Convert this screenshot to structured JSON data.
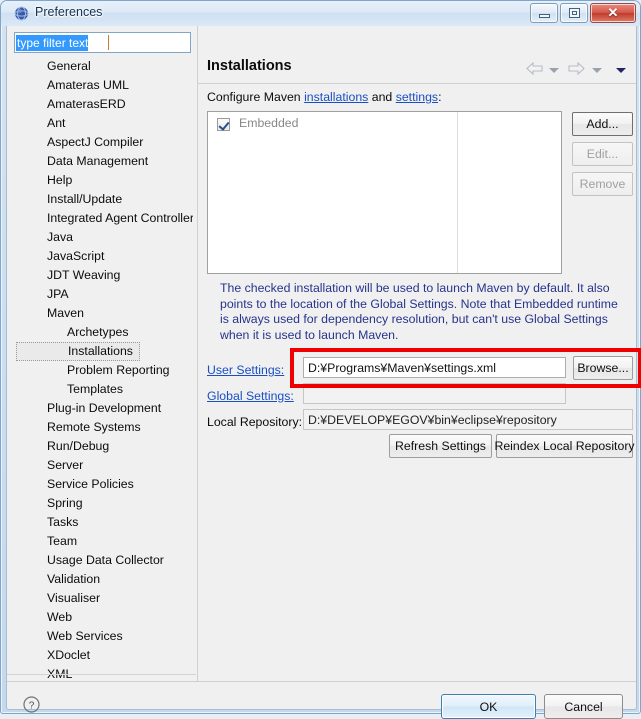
{
  "window": {
    "title": "Preferences",
    "icon": "globe-icon",
    "minimize_label": "Minimize",
    "maximize_label": "Maximize",
    "close_label": "✕"
  },
  "filter": {
    "value": "type filter text",
    "placeholder": "type filter text"
  },
  "tree": {
    "items": [
      {
        "label": "General",
        "level": 0,
        "selected": false
      },
      {
        "label": "Amateras UML",
        "level": 0,
        "selected": false
      },
      {
        "label": "AmaterasERD",
        "level": 0,
        "selected": false
      },
      {
        "label": "Ant",
        "level": 0,
        "selected": false
      },
      {
        "label": "AspectJ Compiler",
        "level": 0,
        "selected": false
      },
      {
        "label": "Data Management",
        "level": 0,
        "selected": false
      },
      {
        "label": "Help",
        "level": 0,
        "selected": false
      },
      {
        "label": "Install/Update",
        "level": 0,
        "selected": false
      },
      {
        "label": "Integrated Agent Controller",
        "level": 0,
        "selected": false
      },
      {
        "label": "Java",
        "level": 0,
        "selected": false
      },
      {
        "label": "JavaScript",
        "level": 0,
        "selected": false
      },
      {
        "label": "JDT Weaving",
        "level": 0,
        "selected": false
      },
      {
        "label": "JPA",
        "level": 0,
        "selected": false
      },
      {
        "label": "Maven",
        "level": 0,
        "selected": false
      },
      {
        "label": "Archetypes",
        "level": 1,
        "selected": false
      },
      {
        "label": "Installations",
        "level": 1,
        "selected": true
      },
      {
        "label": "Problem Reporting",
        "level": 1,
        "selected": false
      },
      {
        "label": "Templates",
        "level": 1,
        "selected": false
      },
      {
        "label": "Plug-in Development",
        "level": 0,
        "selected": false
      },
      {
        "label": "Remote Systems",
        "level": 0,
        "selected": false
      },
      {
        "label": "Run/Debug",
        "level": 0,
        "selected": false
      },
      {
        "label": "Server",
        "level": 0,
        "selected": false
      },
      {
        "label": "Service Policies",
        "level": 0,
        "selected": false
      },
      {
        "label": "Spring",
        "level": 0,
        "selected": false
      },
      {
        "label": "Tasks",
        "level": 0,
        "selected": false
      },
      {
        "label": "Team",
        "level": 0,
        "selected": false
      },
      {
        "label": "Usage Data Collector",
        "level": 0,
        "selected": false
      },
      {
        "label": "Validation",
        "level": 0,
        "selected": false
      },
      {
        "label": "Visualiser",
        "level": 0,
        "selected": false
      },
      {
        "label": "Web",
        "level": 0,
        "selected": false
      },
      {
        "label": "Web Services",
        "level": 0,
        "selected": false
      },
      {
        "label": "XDoclet",
        "level": 0,
        "selected": false
      },
      {
        "label": "XML",
        "level": 0,
        "selected": false
      }
    ]
  },
  "page": {
    "title": "Installations",
    "nav": {
      "back_label": "Back",
      "forward_label": "Forward",
      "menu_label": "View Menu"
    },
    "configure": {
      "prefix": "Configure Maven ",
      "link1": "installations",
      "middle": " and ",
      "link2": "settings",
      "suffix": ":"
    },
    "installations": {
      "rows": [
        {
          "name": "Embedded",
          "checked": true
        }
      ],
      "buttons": {
        "add": "Add...",
        "edit": "Edit...",
        "remove": "Remove"
      }
    },
    "info_text": "The checked installation will be used to launch Maven by default. It also points to the location of the Global Settings. Note that Embedded runtime is always used for dependency resolution, but can't use Global Settings when it is used to launch Maven.",
    "fields": {
      "user_settings_label": "User Settings:",
      "user_settings_value": "D:¥Programs¥Maven¥settings.xml",
      "user_settings_browse": "Browse...",
      "global_settings_label": "Global Settings:",
      "global_settings_value": "",
      "local_repository_label": "Local Repository:",
      "local_repository_value": "D:¥DEVELOP¥EGOV¥bin¥eclipse¥repository"
    },
    "actions": {
      "refresh": "Refresh Settings",
      "reindex": "Reindex Local Repository"
    }
  },
  "footer": {
    "help_label": "?",
    "ok": "OK",
    "cancel": "Cancel"
  },
  "annotation": {
    "color": "#ef0000",
    "target": "user-settings-row"
  }
}
